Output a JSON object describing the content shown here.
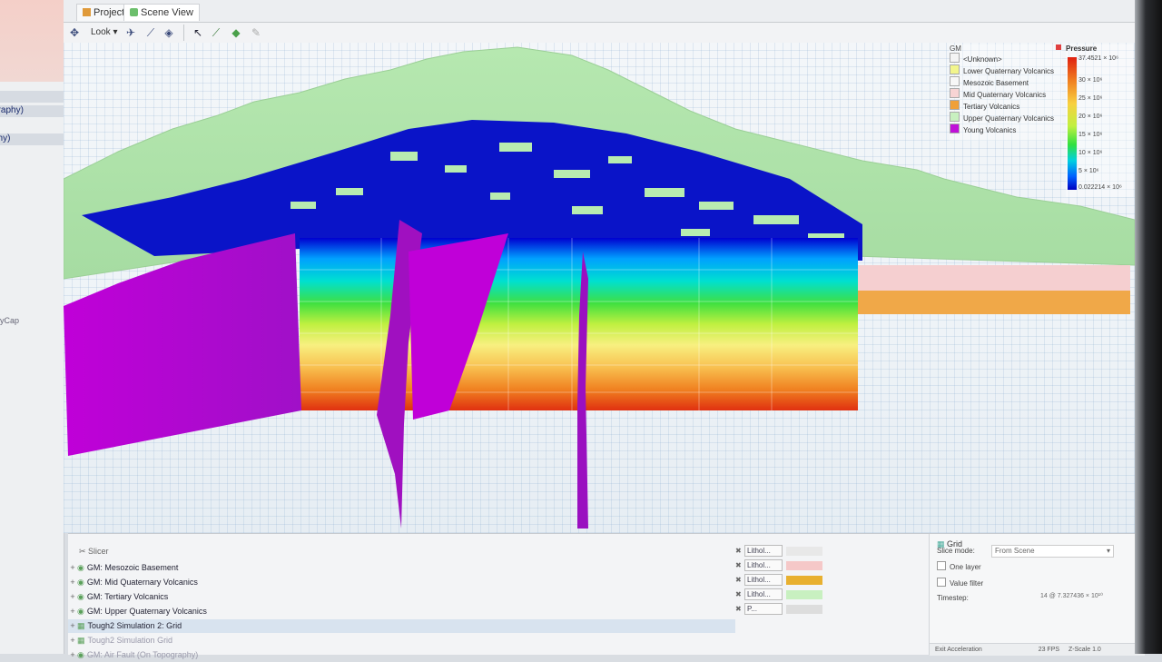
{
  "left_panel": {
    "items": [
      "y)",
      "graphy)",
      "phy)",
      "yCap"
    ]
  },
  "tabs": [
    {
      "label": "Projects",
      "icon": "folder-icon"
    },
    {
      "label": "Scene View",
      "icon": "scene-icon"
    }
  ],
  "toolbar": {
    "look_label": "Look",
    "tools": [
      "pointer-tool-icon",
      "pick-tool-icon",
      "paint-tool-icon",
      "brush-tool-icon",
      "pencil-tool-icon"
    ]
  },
  "gm_legend": {
    "title": "GM",
    "items": [
      {
        "label": "<Unknown>",
        "color": "#f4f4f4"
      },
      {
        "label": "Lower Quaternary Volcanics",
        "color": "#f2f58c"
      },
      {
        "label": "Mesozoic Basement",
        "color": "#f7f7f7"
      },
      {
        "label": "Mid Quaternary Volcanics",
        "color": "#f7d4d4"
      },
      {
        "label": "Tertiary Volcanics",
        "color": "#f0a038"
      },
      {
        "label": "Upper Quaternary Volcanics",
        "color": "#c8f0c0"
      },
      {
        "label": "Young Volcanics",
        "color": "#c010d8"
      }
    ]
  },
  "pressure_legend": {
    "title": "Pressure",
    "ticks": [
      "37.4521 × 10⁶",
      "30 × 10⁶",
      "25 × 10⁶",
      "20 × 10⁶",
      "15 × 10⁶",
      "10 × 10⁶",
      "5 × 10⁶",
      "0.022214 × 10⁶"
    ]
  },
  "slicer": {
    "label": "Slicer",
    "rows": [
      {
        "prefix": "GM:",
        "label": "Mesozoic Basement"
      },
      {
        "prefix": "GM:",
        "label": "Mid Quaternary Volcanics"
      },
      {
        "prefix": "GM:",
        "label": "Tertiary Volcanics"
      },
      {
        "prefix": "GM:",
        "label": "Upper Quaternary Volcanics"
      },
      {
        "prefix": "",
        "label": "Tough2 Simulation 2: Grid"
      },
      {
        "prefix": "",
        "label": "Tough2 Simulation Grid"
      },
      {
        "prefix": "GM:",
        "label": "Air Fault (On Topography)"
      }
    ]
  },
  "layer_props": {
    "rows": [
      {
        "mode": "Lithol...",
        "color": "#e8e8e8"
      },
      {
        "mode": "Lithol...",
        "color": "#f5c8c8"
      },
      {
        "mode": "Lithol...",
        "color": "#e8b030"
      },
      {
        "mode": "Lithol...",
        "color": "#c8f0c0"
      },
      {
        "mode": "P...",
        "color": "#dddddd"
      }
    ]
  },
  "grid_panel": {
    "title": "Grid",
    "slice_mode_label": "Slice mode:",
    "slice_mode_value": "From Scene",
    "one_layer_label": "One layer",
    "value_filter_label": "Value filter",
    "timestep_label": "Timestep:",
    "timestep_value": "14 @ 7.327436 × 10¹⁰"
  },
  "status_bar": {
    "accel_label": "Exit Acceleration",
    "fps": "23 FPS",
    "zscale": "Z-Scale 1.0"
  }
}
